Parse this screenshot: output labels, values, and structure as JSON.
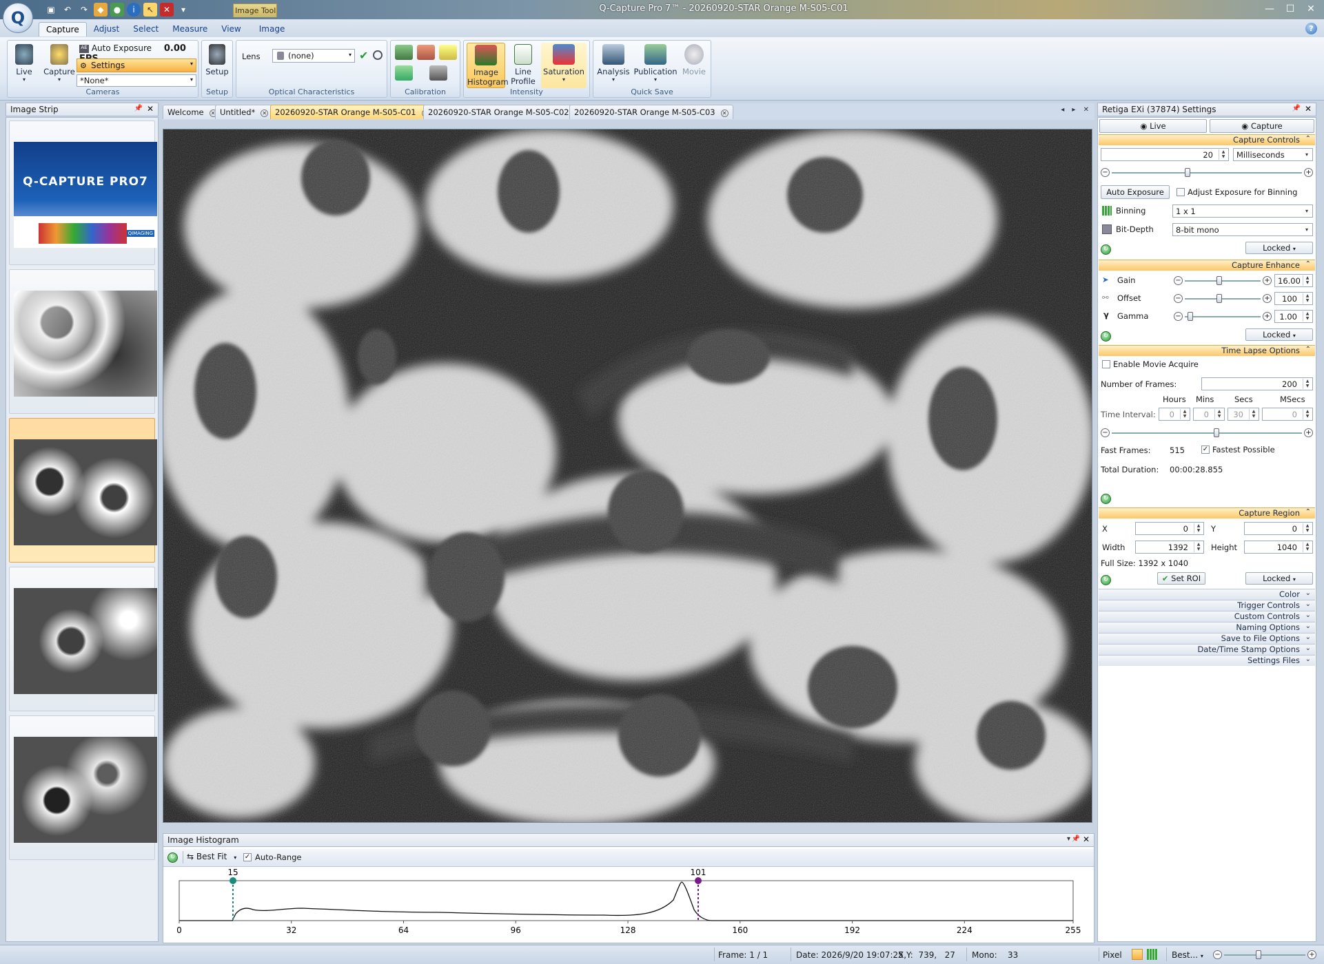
{
  "window": {
    "title": "Q-Capture Pro 7™ - 20260920-STAR Orange M-S05-C01",
    "context_tab": "Image Tools"
  },
  "menu": {
    "tabs": [
      "Capture",
      "Adjust",
      "Select",
      "Measure",
      "View",
      "Image"
    ],
    "active": "Capture"
  },
  "ribbon": {
    "cameras": {
      "label": "Cameras",
      "live": "Live",
      "capture": "Capture",
      "auto_exposure": "Auto Exposure",
      "fps": "0.00 FPS",
      "settings": "Settings",
      "preset": "*None*"
    },
    "setup": {
      "label": "Setup",
      "button": "Setup"
    },
    "optical": {
      "label": "Optical Characteristics",
      "lens_label": "Lens",
      "lens_value": "(none)"
    },
    "calibration": {
      "label": "Calibration"
    },
    "intensity": {
      "label": "Intensity",
      "histogram": "Image Histogram",
      "line_profile": "Line Profile",
      "saturation": "Saturation"
    },
    "quick_save": {
      "label": "Quick Save",
      "analysis": "Analysis",
      "publication": "Publication",
      "movie": "Movie"
    }
  },
  "image_strip": {
    "title": "Image Strip",
    "splash_title": "Q-CAPTURE PRO7",
    "splash_brand": "QIMAGING"
  },
  "doc_tabs": [
    {
      "label": "Welcome"
    },
    {
      "label": "Untitled*"
    },
    {
      "label": "20260920-STAR Orange M-S05-C01"
    },
    {
      "label": "20260920-STAR Orange M-S05-C02"
    },
    {
      "label": "20260920-STAR Orange M-S05-C03"
    }
  ],
  "histogram": {
    "title": "Image Histogram",
    "fit": "Best Fit",
    "auto_range": "Auto-Range",
    "low_marker": "15",
    "high_marker": "101",
    "x_ticks": [
      "0",
      "32",
      "64",
      "96",
      "128",
      "160",
      "192",
      "224",
      "255"
    ]
  },
  "settings": {
    "title": "Retiga EXi (37874) Settings",
    "live": "Live",
    "capture": "Capture",
    "capture_controls": {
      "header": "Capture Controls",
      "exposure": "20",
      "unit": "Milliseconds",
      "auto_exposure": "Auto Exposure",
      "adjust_binning": "Adjust Exposure for Binning",
      "binning_label": "Binning",
      "binning": "1 x 1",
      "bitdepth_label": "Bit-Depth",
      "bitdepth": "8-bit mono",
      "locked": "Locked"
    },
    "capture_enhance": {
      "header": "Capture Enhance",
      "gain_label": "Gain",
      "gain": "16.00",
      "offset_label": "Offset",
      "offset": "100",
      "gamma_label": "Gamma",
      "gamma": "1.00",
      "locked": "Locked"
    },
    "time_lapse": {
      "header": "Time Lapse Options",
      "enable": "Enable Movie Acquire",
      "frames_label": "Number of Frames:",
      "frames": "200",
      "hours_label": "Hours",
      "mins_label": "Mins",
      "secs_label": "Secs",
      "msecs_label": "MSecs",
      "interval_label": "Time Interval:",
      "hours": "0",
      "mins": "0",
      "secs": "30",
      "msecs": "0",
      "fast_frames_label": "Fast Frames:",
      "fast_frames": "515",
      "fastest": "Fastest Possible",
      "duration_label": "Total Duration:",
      "duration": "00:00:28.855"
    },
    "capture_region": {
      "header": "Capture Region",
      "x_label": "X",
      "x": "0",
      "y_label": "Y",
      "y": "0",
      "width_label": "Width",
      "width": "1392",
      "height_label": "Height",
      "height": "1040",
      "full_size": "Full Size: 1392 x 1040",
      "set_roi": "Set ROI",
      "locked": "Locked"
    },
    "collapsed_sections": [
      "Color",
      "Trigger Controls",
      "Custom Controls",
      "Naming Options",
      "Save to File Options",
      "Date/Time Stamp Options",
      "Settings Files"
    ]
  },
  "status": {
    "frame": "Frame: 1 / 1",
    "date": "Date: 2026/9/20 19:07:25",
    "xy": "X,Y:  739,   27",
    "mono": "Mono:    33",
    "pixel": "Pixel",
    "zoom": "Best..."
  },
  "colors": {
    "accent": "#fcc768",
    "ribbon": "#dfe8f3",
    "histogram_low": "#1a8a7a",
    "histogram_high": "#7a1a8a"
  }
}
